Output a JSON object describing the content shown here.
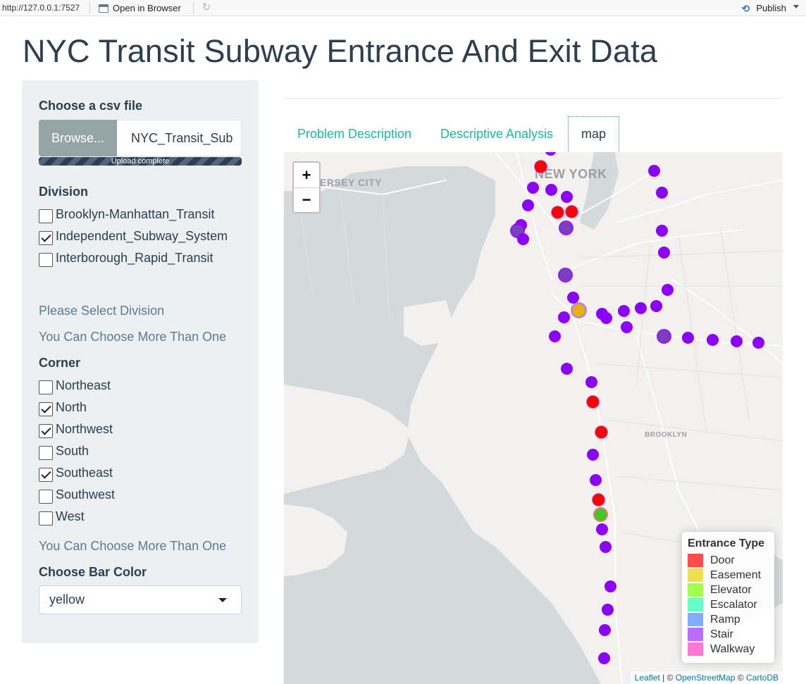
{
  "toolbar": {
    "url": "http://127.0.0.1:7527",
    "open_in_browser": "Open in Browser",
    "publish": "Publish"
  },
  "page": {
    "title": "NYC Transit Subway Entrance And Exit Data"
  },
  "sidebar": {
    "file_label": "Choose a csv file",
    "browse_label": "Browse...",
    "file_name": "NYC_Transit_Sub",
    "upload_status": "Upload complete",
    "division_label": "Division",
    "divisions": [
      {
        "label": "Brooklyn-Manhattan_Transit",
        "checked": false
      },
      {
        "label": "Independent_Subway_System",
        "checked": true
      },
      {
        "label": "Interborough_Rapid_Transit",
        "checked": false
      }
    ],
    "division_help_1": "Please Select Division",
    "division_help_2": "You Can Choose More Than One",
    "corner_label": "Corner",
    "corners": [
      {
        "label": "Northeast",
        "checked": false
      },
      {
        "label": "North",
        "checked": true
      },
      {
        "label": "Northwest",
        "checked": true
      },
      {
        "label": "South",
        "checked": false
      },
      {
        "label": "Southeast",
        "checked": true
      },
      {
        "label": "Southwest",
        "checked": false
      },
      {
        "label": "West",
        "checked": false
      }
    ],
    "corner_help": "You Can Choose More Than One",
    "bar_color_label": "Choose Bar Color",
    "bar_color_value": "yellow"
  },
  "tabs": [
    {
      "label": "Problem Description",
      "active": false
    },
    {
      "label": "Descriptive Analysis",
      "active": false
    },
    {
      "label": "map",
      "active": true
    }
  ],
  "map": {
    "zoom_in": "+",
    "zoom_out": "−",
    "labels": {
      "new_york": "NEW YORK",
      "jersey_city": "ERSEY CITY",
      "brooklyn": "BROOKLYN"
    },
    "legend": {
      "title": "Entrance Type",
      "items": [
        {
          "label": "Door",
          "color": "#ff0000"
        },
        {
          "label": "Easement",
          "color": "#e8d200"
        },
        {
          "label": "Elevator",
          "color": "#7cff00"
        },
        {
          "label": "Escalator",
          "color": "#22ffb0"
        },
        {
          "label": "Ramp",
          "color": "#4a8cff"
        },
        {
          "label": "Stair",
          "color": "#9b30ff"
        },
        {
          "label": "Walkway",
          "color": "#ff3ec8"
        }
      ]
    },
    "attribution": {
      "leaflet": "Leaflet",
      "sep": " | © ",
      "osm": "OpenStreetMap",
      "copy": " © ",
      "carto": "CartoDB"
    },
    "colors": {
      "stair": "#8b00ff",
      "door": "#ff0000",
      "easement": "#e8b000",
      "elevator": "#3ccc1e",
      "mixed": "#7a3fbf"
    }
  }
}
